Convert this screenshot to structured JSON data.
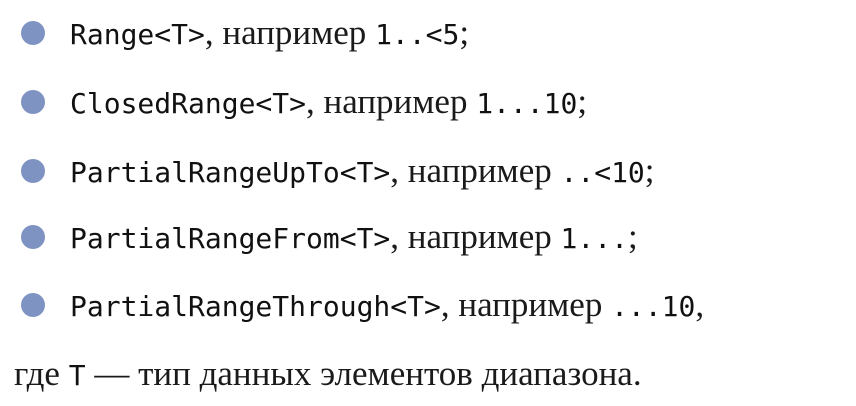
{
  "items": [
    {
      "type": "Range<T>",
      "sep": ", например ",
      "example": "1..<5",
      "end": ";"
    },
    {
      "type": "ClosedRange<T>",
      "sep": ", например ",
      "example": "1...10",
      "end": ";"
    },
    {
      "type": "PartialRangeUpTo<T>",
      "sep": ", например ",
      "example": "..<10",
      "end": ";"
    },
    {
      "type": "PartialRangeFrom<T>",
      "sep": ", например ",
      "example": "1...",
      "end": ";"
    },
    {
      "type": "PartialRangeThrough<T>",
      "sep": ", например ",
      "example": "...10",
      "end": ","
    }
  ],
  "footer": {
    "prefix": "где ",
    "code": "T",
    "suffix": " — тип данных элементов диапазона."
  },
  "colors": {
    "bullet": "#7f93c3",
    "text": "#1a1a1a"
  }
}
